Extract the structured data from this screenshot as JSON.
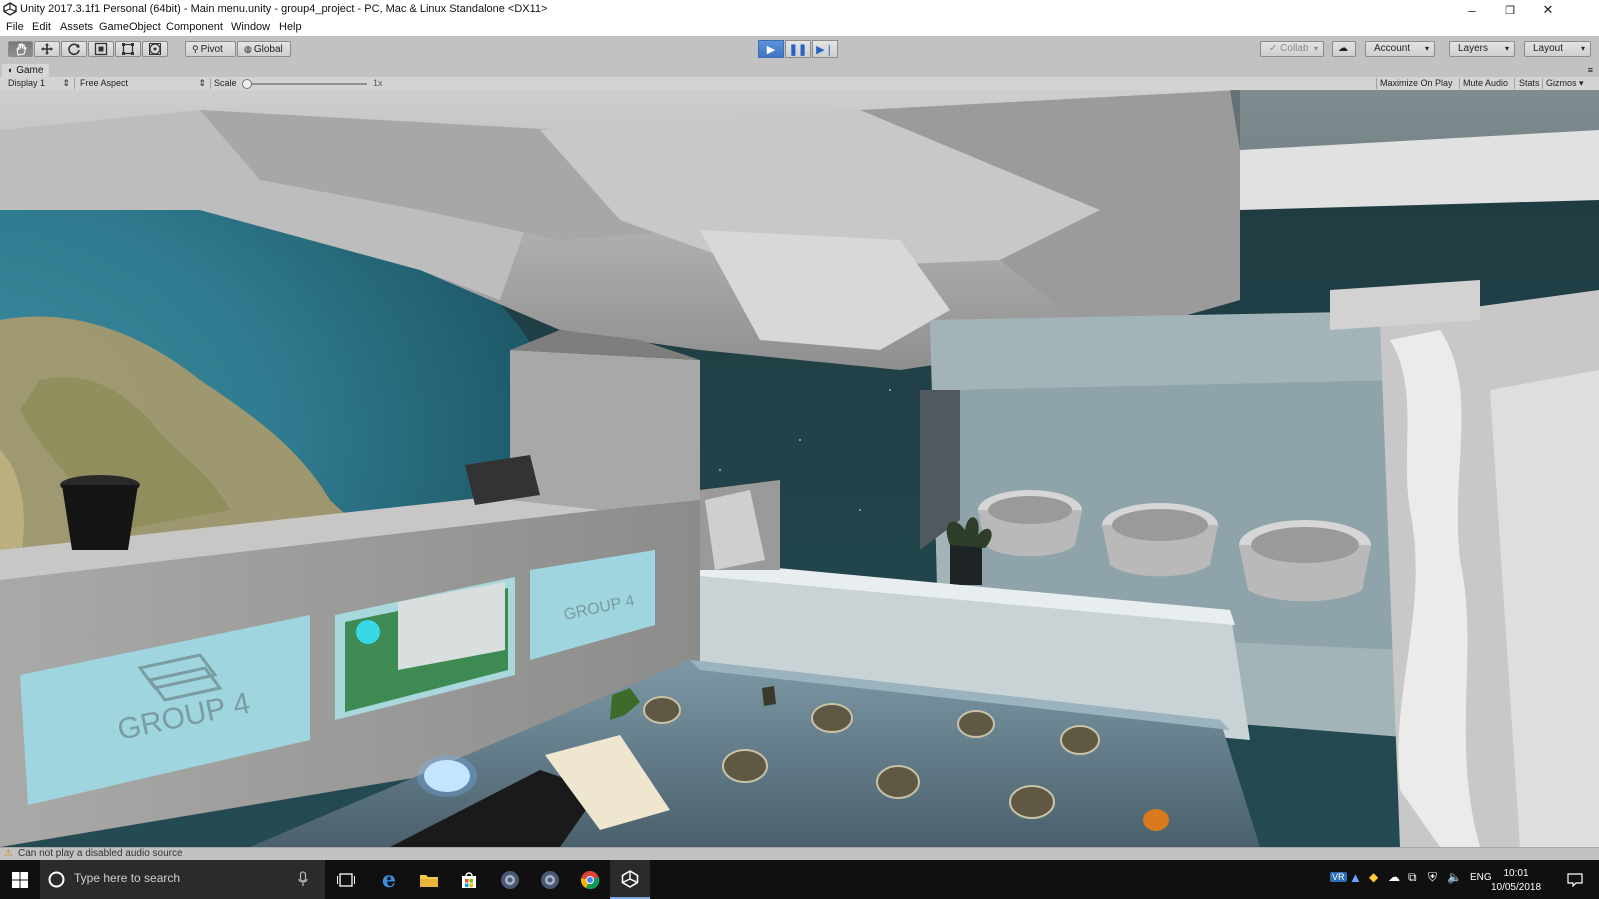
{
  "window": {
    "title": "Unity 2017.3.1f1 Personal (64bit) - Main menu.unity - group4_project - PC, Mac & Linux Standalone <DX11>",
    "minimize_glyph": "–",
    "restore_glyph": "❐",
    "close_glyph": "✕"
  },
  "menu": [
    "File",
    "Edit",
    "Assets",
    "GameObject",
    "Component",
    "Window",
    "Help"
  ],
  "toolbar": {
    "transform_tools": [
      "hand-tool-icon",
      "move-tool-icon",
      "rotate-tool-icon",
      "scale-tool-icon",
      "rect-tool-icon",
      "transform-tool-icon"
    ],
    "pivot_label": "Pivot",
    "global_label": "Global",
    "collab_label": "Collab",
    "account_label": "Account",
    "layers_label": "Layers",
    "layout_label": "Layout",
    "play_state": "playing"
  },
  "game_panel": {
    "tab_label": "Game",
    "display_label": "Display 1",
    "aspect_label": "Free Aspect",
    "scale_label": "Scale",
    "scale_value": "1x",
    "maximize_label": "Maximize On Play",
    "mute_label": "Mute Audio",
    "stats_label": "Stats",
    "gizmos_label": "Gizmos"
  },
  "scene": {
    "sign_left": "GROUP 4",
    "sign_right": "GROUP 4"
  },
  "status": {
    "message": "Can not play a disabled audio source"
  },
  "taskbar": {
    "search_placeholder": "Type here to search",
    "language": "ENG",
    "time": "10:01",
    "date": "10/05/2018",
    "vr_label": "VR"
  }
}
